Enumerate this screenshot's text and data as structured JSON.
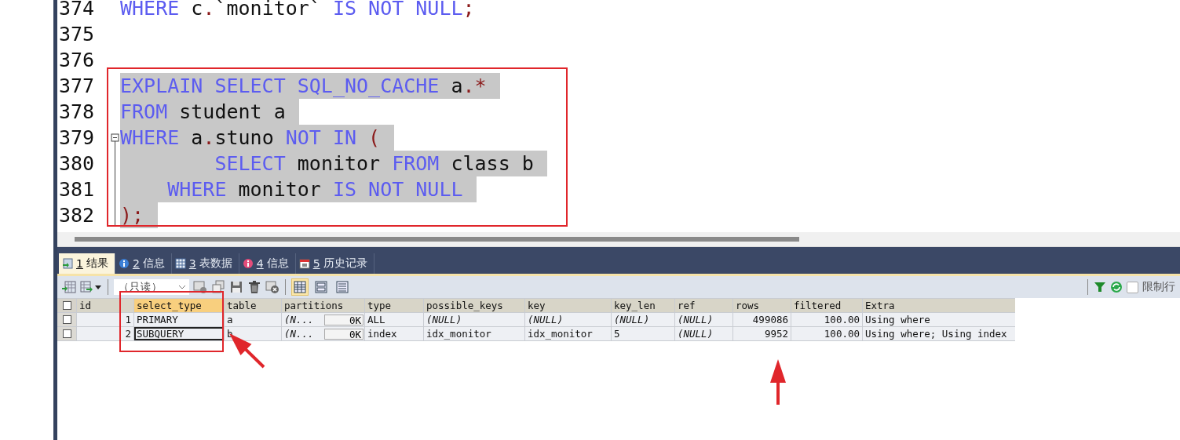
{
  "editor": {
    "lines": [
      {
        "number": "374",
        "selected": false,
        "fold_start": false,
        "tokens": [
          {
            "kind": "keyword",
            "text": "WHERE "
          },
          {
            "kind": "ident",
            "text": "c"
          },
          {
            "kind": "punct",
            "text": "."
          },
          {
            "kind": "ident",
            "text": "`monitor` "
          },
          {
            "kind": "keyword",
            "text": "IS NOT NULL"
          },
          {
            "kind": "punct",
            "text": ";"
          }
        ]
      },
      {
        "number": "375",
        "fold_start": false
      },
      {
        "number": "376",
        "fold_start": false
      },
      {
        "number": "377",
        "selected": true,
        "fold_start": false,
        "tokens": [
          {
            "kind": "keyword",
            "text": "EXPLAIN SELECT SQL_NO_CACHE "
          },
          {
            "kind": "ident",
            "text": "a"
          },
          {
            "kind": "punct",
            "text": ".*"
          }
        ]
      },
      {
        "number": "378",
        "selected": true,
        "fold_start": false,
        "tokens": [
          {
            "kind": "keyword",
            "text": "FROM "
          },
          {
            "kind": "ident",
            "text": "student a"
          }
        ]
      },
      {
        "number": "379",
        "selected": true,
        "fold_start": true,
        "tokens": [
          {
            "kind": "keyword",
            "text": "WHERE "
          },
          {
            "kind": "ident",
            "text": "a"
          },
          {
            "kind": "punct",
            "text": "."
          },
          {
            "kind": "ident",
            "text": "stuno "
          },
          {
            "kind": "keyword",
            "text": "NOT IN "
          },
          {
            "kind": "punct",
            "text": "("
          }
        ]
      },
      {
        "number": "380",
        "selected": true,
        "fold_start": false,
        "tokens": [
          {
            "kind": "keyword",
            "text": "        SELECT "
          },
          {
            "kind": "ident",
            "text": "monitor "
          },
          {
            "kind": "keyword",
            "text": "FROM "
          },
          {
            "kind": "ident",
            "text": "class b"
          }
        ]
      },
      {
        "number": "381",
        "selected": true,
        "fold_start": false,
        "tokens": [
          {
            "kind": "keyword",
            "text": "    WHERE "
          },
          {
            "kind": "ident",
            "text": "monitor "
          },
          {
            "kind": "keyword",
            "text": "IS NOT NULL"
          }
        ]
      },
      {
        "number": "382",
        "selected": true,
        "fold_start": false,
        "tokens": [
          {
            "kind": "punct",
            "text": ");"
          }
        ]
      }
    ]
  },
  "result_tabs": [
    {
      "number": "1",
      "label": "结果",
      "selected": true
    },
    {
      "number": "2",
      "label": "信息",
      "selected": false
    },
    {
      "number": "3",
      "label": "表数据",
      "selected": false
    },
    {
      "number": "4",
      "label": "信息",
      "selected": false
    },
    {
      "number": "5",
      "label": "历史记录",
      "selected": false
    }
  ],
  "toolbar": {
    "mode_dropdown": {
      "value": "（只读）"
    },
    "view_buttons": [
      {
        "selected": true
      },
      {
        "selected": false
      },
      {
        "selected": false
      }
    ],
    "limit_rows": {
      "label": "限制行",
      "checked": false
    }
  },
  "grid": {
    "select_all": {
      "checked": false
    },
    "columns": [
      {
        "label": "id",
        "kind": "number",
        "selected": false
      },
      {
        "label": "select_type",
        "kind": "text",
        "selected": true
      },
      {
        "label": "table",
        "kind": "text",
        "selected": false
      },
      {
        "label": "partitions",
        "kind": "blob",
        "selected": false
      },
      {
        "label": "type",
        "kind": "text",
        "selected": false
      },
      {
        "label": "possible_keys",
        "kind": "text",
        "selected": false
      },
      {
        "label": "key",
        "kind": "text",
        "selected": false
      },
      {
        "label": "key_len",
        "kind": "text",
        "selected": false
      },
      {
        "label": "ref",
        "kind": "text",
        "selected": false
      },
      {
        "label": "rows",
        "kind": "number",
        "selected": false
      },
      {
        "label": "filtered",
        "kind": "number",
        "selected": false
      },
      {
        "label": "Extra",
        "kind": "text",
        "selected": false
      }
    ],
    "rows": [
      {
        "checked": false,
        "cells": [
          {
            "text": "1",
            "null": false,
            "focused": false
          },
          {
            "text": "PRIMARY",
            "null": false,
            "focused": false
          },
          {
            "text": "a",
            "null": false,
            "focused": false
          },
          {
            "text": "(N...",
            "null": true,
            "focused": false,
            "blob": "0K"
          },
          {
            "text": "ALL",
            "null": false,
            "focused": false
          },
          {
            "text": "(NULL)",
            "null": true,
            "focused": false
          },
          {
            "text": "(NULL)",
            "null": true,
            "focused": false
          },
          {
            "text": "(NULL)",
            "null": true,
            "focused": false
          },
          {
            "text": "(NULL)",
            "null": true,
            "focused": false
          },
          {
            "text": "499086",
            "null": false,
            "focused": false
          },
          {
            "text": "100.00",
            "null": false,
            "focused": false
          },
          {
            "text": "Using where",
            "null": false,
            "focused": false
          }
        ]
      },
      {
        "checked": false,
        "cells": [
          {
            "text": "2",
            "null": false,
            "focused": false
          },
          {
            "text": "SUBQUERY",
            "null": false,
            "focused": true
          },
          {
            "text": "b",
            "null": false,
            "focused": false
          },
          {
            "text": "(N...",
            "null": true,
            "focused": false,
            "blob": "0K"
          },
          {
            "text": "index",
            "null": false,
            "focused": false
          },
          {
            "text": "idx_monitor",
            "null": false,
            "focused": false
          },
          {
            "text": "idx_monitor",
            "null": false,
            "focused": false
          },
          {
            "text": "5",
            "null": false,
            "focused": false
          },
          {
            "text": "(NULL)",
            "null": true,
            "focused": false
          },
          {
            "text": "9952",
            "null": false,
            "focused": false
          },
          {
            "text": "100.00",
            "null": false,
            "focused": false
          },
          {
            "text": "Using where; Using index",
            "null": false,
            "focused": false
          }
        ]
      }
    ]
  },
  "annotations": [
    {
      "kind": "box"
    },
    {
      "kind": "box"
    },
    {
      "kind": "arrow"
    },
    {
      "kind": "arrow"
    }
  ]
}
